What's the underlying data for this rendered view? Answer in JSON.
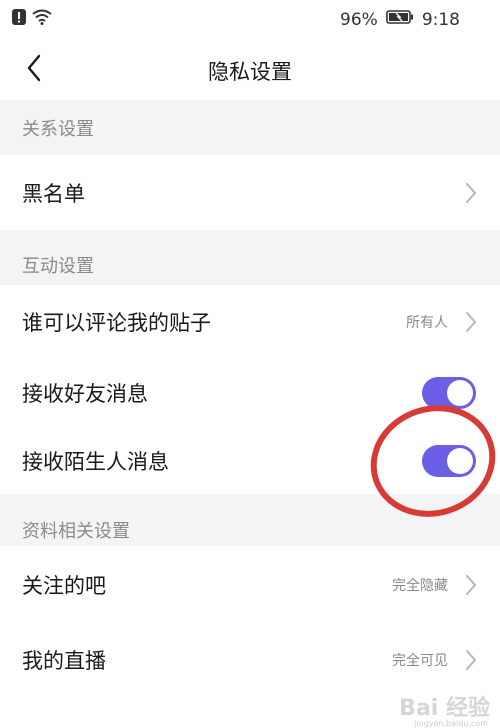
{
  "status_bar": {
    "battery_percent": "96%",
    "time": "9:18",
    "icons": [
      "alert-icon",
      "wifi-icon",
      "battery-icon"
    ]
  },
  "nav": {
    "title": "隐私设置",
    "back_icon": "chevron-left-icon"
  },
  "sections": {
    "relation": {
      "header": "关系设置",
      "items": [
        {
          "label": "黑名单"
        }
      ]
    },
    "interaction": {
      "header": "互动设置",
      "items": [
        {
          "label": "谁可以评论我的贴子",
          "value": "所有人"
        },
        {
          "label": "接收好友消息",
          "toggle_on": true
        },
        {
          "label": "接收陌生人消息",
          "toggle_on": true
        }
      ]
    },
    "profile": {
      "header": "资料相关设置",
      "items": [
        {
          "label": "关注的吧",
          "value": "完全隐藏"
        },
        {
          "label": "我的直播",
          "value": "完全可见"
        }
      ]
    }
  },
  "colors": {
    "toggle_on": "#6b5fe8",
    "annotation": "#d63b36",
    "section_bg": "#f4f4f6"
  },
  "watermark": {
    "text": "Bai 经验",
    "sub": "jingyan.baidu.com"
  }
}
